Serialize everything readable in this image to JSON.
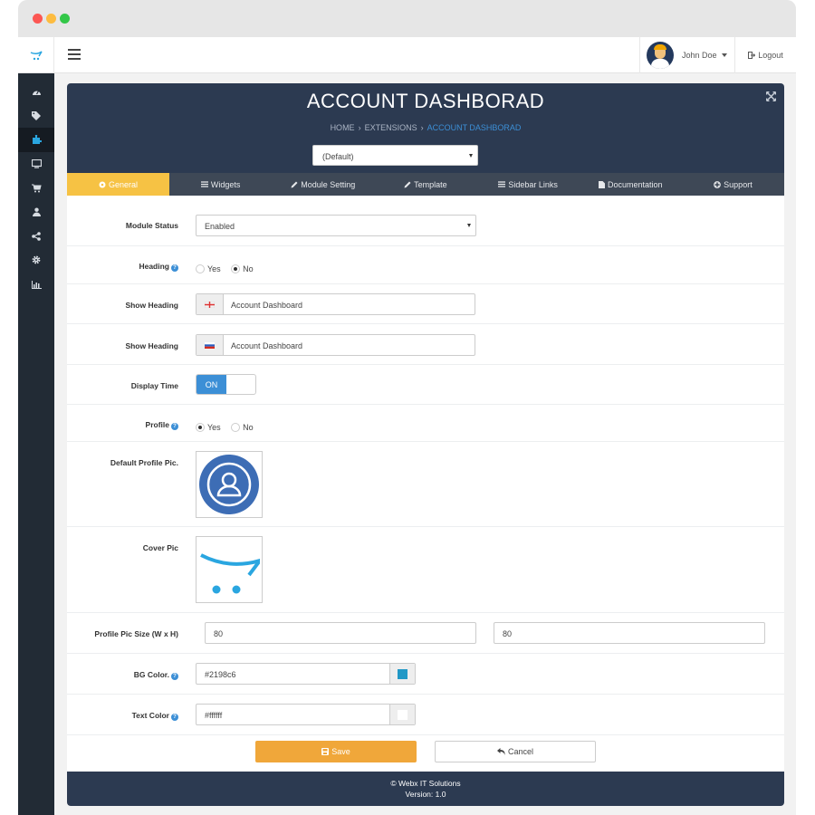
{
  "topbar": {
    "user_name": "John Doe",
    "logout_label": "Logout"
  },
  "sidebar": {
    "items": [
      {
        "icon": "dashboard-icon"
      },
      {
        "icon": "tags-icon"
      },
      {
        "icon": "puzzle-icon",
        "active": true
      },
      {
        "icon": "monitor-icon"
      },
      {
        "icon": "cart-icon"
      },
      {
        "icon": "user-icon"
      },
      {
        "icon": "share-icon"
      },
      {
        "icon": "gear-icon"
      },
      {
        "icon": "bar-chart-icon"
      }
    ]
  },
  "header": {
    "title": "ACCOUNT DASHBORAD",
    "breadcrumb": [
      "HOME",
      "EXTENSIONS",
      "ACCOUNT DASHBORAD"
    ],
    "store_select": "(Default)"
  },
  "tabs": [
    {
      "label": "General",
      "active": true
    },
    {
      "label": "Widgets"
    },
    {
      "label": "Module Setting"
    },
    {
      "label": "Template"
    },
    {
      "label": "Sidebar Links"
    },
    {
      "label": "Documentation"
    },
    {
      "label": "Support"
    }
  ],
  "form": {
    "module_status": {
      "label": "Module Status",
      "value": "Enabled"
    },
    "heading": {
      "label": "Heading",
      "options": [
        "Yes",
        "No"
      ],
      "selected": "No"
    },
    "show_heading_en": {
      "label": "Show Heading",
      "value": "Account Dashboard"
    },
    "show_heading_ru": {
      "label": "Show Heading",
      "value": "Account Dashboard"
    },
    "display_time": {
      "label": "Display Time",
      "state": "ON"
    },
    "profile": {
      "label": "Profile",
      "options": [
        "Yes",
        "No"
      ],
      "selected": "Yes"
    },
    "default_profile_pic": {
      "label": "Default Profile Pic."
    },
    "cover_pic": {
      "label": "Cover Pic"
    },
    "profile_pic_size": {
      "label": "Profile Pic Size (W x H)",
      "width": "80",
      "height": "80"
    },
    "bg_color": {
      "label": "BG Color.",
      "value": "#2198c6"
    },
    "text_color": {
      "label": "Text Color",
      "value": "#ffffff"
    }
  },
  "buttons": {
    "save": "Save",
    "cancel": "Cancel"
  },
  "footer": {
    "company": "© Webx IT Solutions",
    "version": "Version: 1.0"
  },
  "colors": {
    "header_bg": "#2c3a51",
    "accent_yellow": "#f6c244",
    "save_orange": "#f0a73a",
    "link_blue": "#3c8fd6",
    "bg_color_swatch": "#2198c6",
    "text_color_swatch": "#ffffff"
  }
}
